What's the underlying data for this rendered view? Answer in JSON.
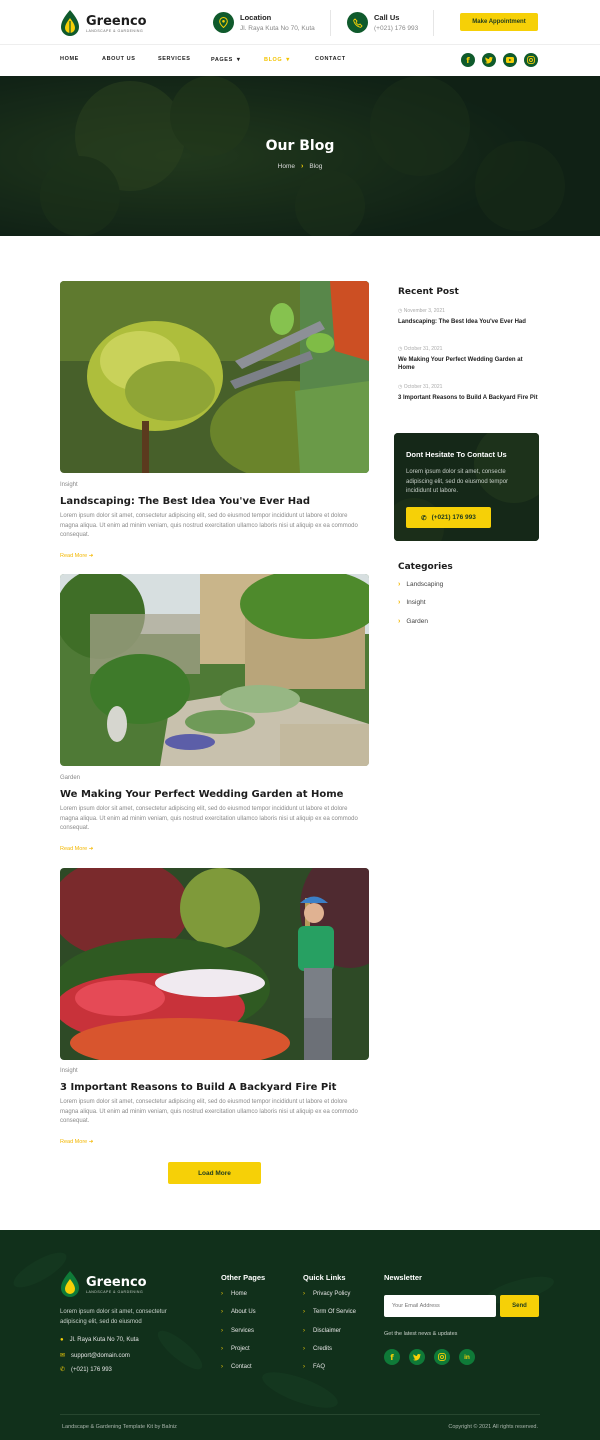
{
  "header": {
    "logo": {
      "name": "Greenco",
      "tagline": "LANDSCAPE & GARDENING"
    },
    "location": {
      "label": "Location",
      "value": "Jl. Raya Kuta No 70, Kuta",
      "icon": "map-pin-icon"
    },
    "call": {
      "label": "Call Us",
      "value": "(+021) 176 993",
      "icon": "phone-icon"
    },
    "cta": "Make Appointment",
    "nav": [
      "HOME",
      "ABOUT US",
      "SERVICES",
      "PAGES",
      "BLOG",
      "CONTACT"
    ],
    "active_nav": "BLOG",
    "socials": [
      "facebook-icon",
      "twitter-icon",
      "youtube-icon",
      "instagram-icon"
    ]
  },
  "hero": {
    "title": "Our Blog",
    "breadcrumb": [
      "Home",
      "Blog"
    ]
  },
  "posts": [
    {
      "category": "Insight",
      "title": "Landscaping: The Best Idea You've Ever Had",
      "excerpt": "Lorem ipsum dolor sit amet, consectetur adipiscing elit, sed do eiusmod tempor incididunt ut labore et dolore magna aliqua. Ut enim ad minim veniam, quis nostrud exercitation ullamco laboris nisi ut aliquip ex ea commodo consequat.",
      "read_more": "Read More"
    },
    {
      "category": "Garden",
      "title": "We Making Your Perfect Wedding Garden at Home",
      "excerpt": "Lorem ipsum dolor sit amet, consectetur adipiscing elit, sed do eiusmod tempor incididunt ut labore et dolore magna aliqua. Ut enim ad minim veniam, quis nostrud exercitation ullamco laboris nisi ut aliquip ex ea commodo consequat.",
      "read_more": "Read More"
    },
    {
      "category": "Insight",
      "title": "3 Important Reasons to Build A Backyard Fire Pit",
      "excerpt": "Lorem ipsum dolor sit amet, consectetur adipiscing elit, sed do eiusmod tempor incididunt ut labore et dolore magna aliqua. Ut enim ad minim veniam, quis nostrud exercitation ullamco laboris nisi ut aliquip ex ea commodo consequat.",
      "read_more": "Read More"
    }
  ],
  "load_more": "Load More",
  "sidebar": {
    "recent_title": "Recent Post",
    "recent": [
      {
        "date": "November 3, 2021",
        "title": "Landscaping: The Best Idea You've Ever Had"
      },
      {
        "date": "October 31, 2021",
        "title": "We Making Your Perfect Wedding Garden at Home"
      },
      {
        "date": "October 31, 2021",
        "title": "3 Important Reasons to Build A Backyard Fire Pit"
      }
    ],
    "contact": {
      "title": "Dont Hesitate To Contact Us",
      "text": "Lorem ipsum dolor sit amet, consecte adipiscing elit, sed do eiusmod tempor incididunt ut labore.",
      "phone": "(+021) 176 993"
    },
    "categories_title": "Categories",
    "categories": [
      "Landscaping",
      "Insight",
      "Garden"
    ]
  },
  "footer": {
    "logo": {
      "name": "Greenco",
      "tagline": "LANDSCAPE & GARDENING"
    },
    "about": "Lorem ipsum dolor sit amet, consectetur adipiscing elit, sed do eiusmod",
    "address": "Jl. Raya Kuta No 70, Kuta",
    "email": "support@domain.com",
    "phone": "(+021) 176 993",
    "other_pages_title": "Other Pages",
    "other_pages": [
      "Home",
      "About Us",
      "Services",
      "Project",
      "Contact"
    ],
    "quick_links_title": "Quick Links",
    "quick_links": [
      "Privacy Policy",
      "Term Of Service",
      "Disclaimer",
      "Credits",
      "FAQ"
    ],
    "newsletter_title": "Newsletter",
    "email_placeholder": "Your Email Address",
    "send": "Send",
    "newsletter_note": "Get the latest news & updates",
    "socials": [
      "facebook-icon",
      "twitter-icon",
      "instagram-icon",
      "linkedin-icon"
    ],
    "credit": "Landscape & Gardening Template Kit by Balniz",
    "copyright": "Copyright © 2021 All rights reserved."
  },
  "colors": {
    "brand_green": "#0f5a2c",
    "accent_yellow": "#f6d007",
    "footer_bg": "#11301b"
  }
}
